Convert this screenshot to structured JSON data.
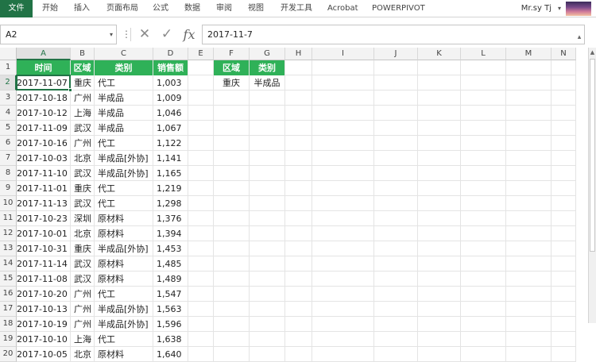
{
  "ribbon": {
    "tabs": [
      "文件",
      "开始",
      "插入",
      "页面布局",
      "公式",
      "数据",
      "审阅",
      "视图",
      "开发工具",
      "Acrobat",
      "POWERPIVOT"
    ],
    "user": "Mr.sy Tj",
    "user_caret": "▾"
  },
  "formula_bar": {
    "name_box": "A2",
    "name_caret": "▾",
    "dots": "⋮",
    "cancel_icon": "✕",
    "enter_icon": "✓",
    "fx_label": "fx",
    "formula": "2017-11-7",
    "expand_icon": "▴"
  },
  "columns": [
    "A",
    "B",
    "C",
    "D",
    "E",
    "F",
    "G",
    "H",
    "I",
    "J",
    "K",
    "L",
    "M",
    "N"
  ],
  "rows": [
    "1",
    "2",
    "3",
    "4",
    "5",
    "6",
    "7",
    "8",
    "9",
    "10",
    "11",
    "12",
    "13",
    "14",
    "15",
    "16",
    "17",
    "18",
    "19",
    "20"
  ],
  "table": {
    "headers": [
      "时间",
      "区域",
      "类别",
      "销售额"
    ],
    "rows": [
      [
        "2017-11-07",
        "重庆",
        "代工",
        "1,003"
      ],
      [
        "2017-10-18",
        "广州",
        "半成品",
        "1,009"
      ],
      [
        "2017-10-12",
        "上海",
        "半成品",
        "1,046"
      ],
      [
        "2017-11-09",
        "武汉",
        "半成品",
        "1,067"
      ],
      [
        "2017-10-16",
        "广州",
        "代工",
        "1,122"
      ],
      [
        "2017-10-03",
        "北京",
        "半成品[外协]",
        "1,141"
      ],
      [
        "2017-11-10",
        "武汉",
        "半成品[外协]",
        "1,165"
      ],
      [
        "2017-11-01",
        "重庆",
        "代工",
        "1,219"
      ],
      [
        "2017-11-13",
        "武汉",
        "代工",
        "1,298"
      ],
      [
        "2017-10-23",
        "深圳",
        "原材料",
        "1,376"
      ],
      [
        "2017-10-01",
        "北京",
        "原材料",
        "1,394"
      ],
      [
        "2017-10-31",
        "重庆",
        "半成品[外协]",
        "1,453"
      ],
      [
        "2017-11-14",
        "武汉",
        "原材料",
        "1,485"
      ],
      [
        "2017-11-08",
        "武汉",
        "原材料",
        "1,489"
      ],
      [
        "2017-10-20",
        "广州",
        "代工",
        "1,547"
      ],
      [
        "2017-10-13",
        "广州",
        "半成品[外协]",
        "1,563"
      ],
      [
        "2017-10-19",
        "广州",
        "半成品[外协]",
        "1,596"
      ],
      [
        "2017-10-10",
        "上海",
        "代工",
        "1,638"
      ],
      [
        "2017-10-05",
        "北京",
        "原材料",
        "1,640"
      ]
    ]
  },
  "criteria": {
    "headers": [
      "区域",
      "类别"
    ],
    "values": [
      "重庆",
      "半成品"
    ]
  },
  "colors": {
    "header_green": "#2fb158",
    "excel_green": "#217346"
  }
}
